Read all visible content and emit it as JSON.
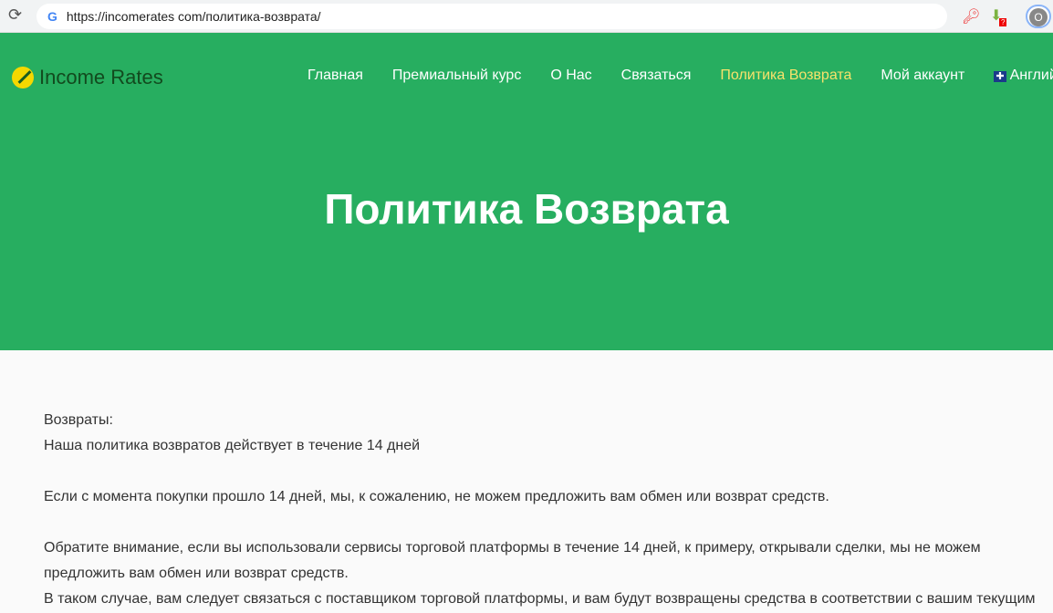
{
  "browser": {
    "url": "https://incomerates com/политика-возврата/",
    "ext_badge": "?",
    "profile_initial": "O"
  },
  "header": {
    "logo": "Income Rates",
    "nav": [
      "Главная",
      "Премиальный курс",
      "О Нас",
      "Связаться",
      "Политика Возврата",
      "Мой аккаунт",
      "Англий"
    ],
    "active_color": "#f7e26b"
  },
  "hero": {
    "title": "Политика Возврата",
    "bg": "#27ae60"
  },
  "content": {
    "lines": [
      "Возвраты:",
      "Наша политика возвратов действует в течение 14 дней",
      "Если с момента покупки прошло 14 дней, мы, к сожалению, не можем предложить вам обмен или возврат средств.",
      "Обратите внимание, если вы использовали сервисы торговой платформы в течение 14 дней, к примеру, открывали сделки, мы не можем предложить вам обмен или возврат средств.",
      "В таком случае, вам следует связаться с поставщиком торговой платформы, и вам будут возвращены средства в соответствии с вашим текущим"
    ]
  }
}
